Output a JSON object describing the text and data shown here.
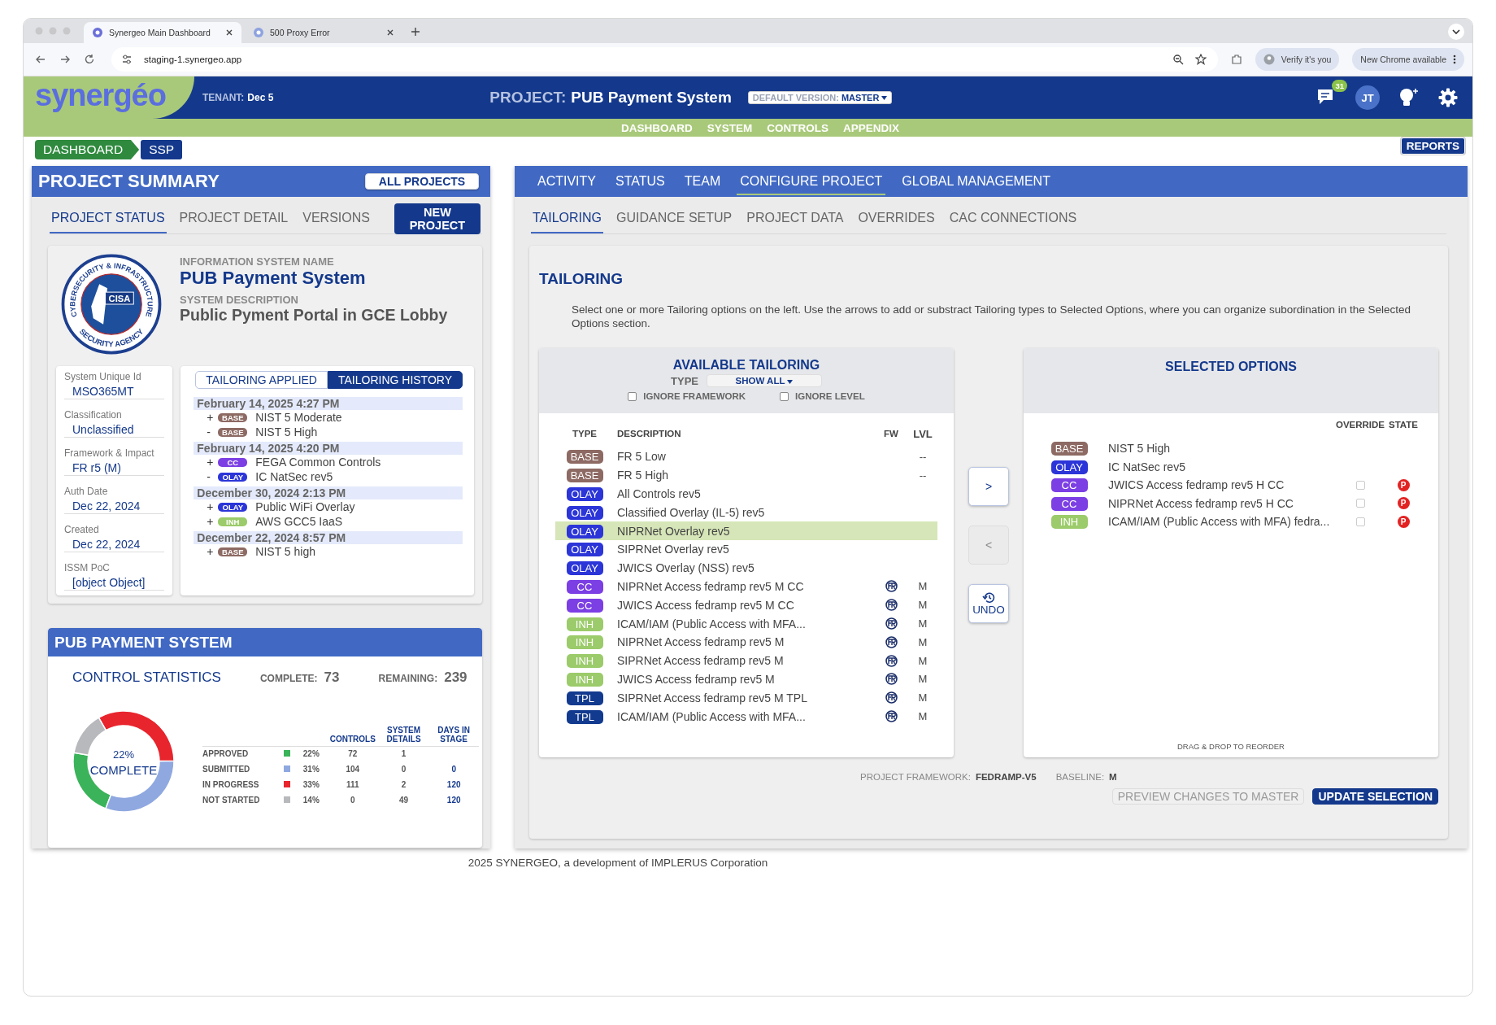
{
  "browser": {
    "tabs": [
      {
        "title": "Synergeo Main Dashboard",
        "selected": true
      },
      {
        "title": "500 Proxy Error",
        "selected": false
      }
    ],
    "address": "staging-1.synergeo.app",
    "verify": "Verify it's you",
    "update": "New Chrome available"
  },
  "header": {
    "logo": "synergéo",
    "tenant_label": "TENANT:",
    "tenant": "Dec 5",
    "project_label": "PROJECT:",
    "project": "PUB Payment System",
    "version_label": "DEFAULT VERSION:",
    "version": "MASTER",
    "notifications": "31",
    "avatar": "JT"
  },
  "nav": [
    "DASHBOARD",
    "SYSTEM",
    "CONTROLS",
    "APPENDIX"
  ],
  "breadcrumb": [
    "DASHBOARD",
    "SSP"
  ],
  "reports": "REPORTS",
  "summary": {
    "title": "PROJECT SUMMARY",
    "all_projects": "ALL PROJECTS",
    "tabs": [
      {
        "label": "PROJECT STATUS",
        "selected": true
      },
      {
        "label": "PROJECT DETAIL",
        "selected": false
      },
      {
        "label": "VERSIONS",
        "selected": false
      }
    ],
    "new_project": "NEW PROJECT",
    "seal": {
      "ring_top": "CYBERSECURITY & INFRASTRUCTURE",
      "ring_bottom": "SECURITY AGENCY",
      "center": "CISA"
    },
    "name_label": "INFORMATION SYSTEM NAME",
    "name": "PUB Payment System",
    "description_label": "SYSTEM DESCRIPTION",
    "description": "Public Pyment Portal in GCE Lobby",
    "details": [
      {
        "label": "System Unique Id",
        "value": "MSO365MT"
      },
      {
        "label": "Classification",
        "value": "Unclassified"
      },
      {
        "label": "Framework & Impact",
        "value": "FR r5 (M)"
      },
      {
        "label": "Auth Date",
        "value": "Dec 22, 2024"
      },
      {
        "label": "Created",
        "value": "Dec 22, 2024"
      },
      {
        "label": "ISSM PoC",
        "value": "[object Object]"
      }
    ],
    "history_tabs": [
      {
        "label": "TAILORING APPLIED",
        "selected": false
      },
      {
        "label": "TAILORING HISTORY",
        "selected": true
      }
    ],
    "history": [
      {
        "date": "February 14, 2025 4:27 PM",
        "changes": [
          {
            "sign": "+",
            "type": "BASE",
            "color": "#8d6a63",
            "name": "NIST 5 Moderate"
          },
          {
            "sign": "-",
            "type": "BASE",
            "color": "#8d6a63",
            "name": "NIST 5 High"
          }
        ]
      },
      {
        "date": "February 14, 2025 4:20 PM",
        "changes": [
          {
            "sign": "+",
            "type": "CC",
            "color": "#7b3fe4",
            "name": "FEGA Common Controls"
          },
          {
            "sign": "-",
            "type": "OLAY",
            "color": "#2b35d8",
            "name": "IC NatSec rev5"
          }
        ]
      },
      {
        "date": "December 30, 2024 2:13 PM",
        "changes": [
          {
            "sign": "+",
            "type": "OLAY",
            "color": "#2b35d8",
            "name": "Public WiFi Overlay"
          },
          {
            "sign": "+",
            "type": "INH",
            "color": "#9bcb6a",
            "name": "AWS GCC5 IaaS"
          }
        ]
      },
      {
        "date": "December 22, 2024 8:57 PM",
        "changes": [
          {
            "sign": "+",
            "type": "BASE",
            "color": "#8d6a63",
            "name": "NIST 5 high"
          }
        ]
      }
    ]
  },
  "stats": {
    "title": "PUB PAYMENT SYSTEM",
    "heading": "CONTROL STATISTICS",
    "complete_label": "COMPLETE:",
    "complete": "73",
    "remaining_label": "REMAINING:",
    "remaining": "239",
    "center_value": "22%",
    "center_label": "COMPLETE",
    "chart_data": {
      "type": "donut",
      "categories": [
        "APPROVED",
        "SUBMITTED",
        "IN PROGRESS",
        "NOT STARTED"
      ],
      "values": [
        22,
        31,
        33,
        14
      ]
    },
    "columns": [
      "CONTROLS",
      "SYSTEM DETAILS",
      "DAYS IN STAGE"
    ],
    "rows": [
      {
        "color": "#3bb35a",
        "pct": "22%",
        "controls": "72",
        "details": "1"
      },
      {
        "color": "#8fa8e0",
        "pct": "31%",
        "controls": "104",
        "details": "0",
        "days": "0"
      },
      {
        "color": "#e8242d",
        "pct": "33%",
        "controls": "111",
        "details": "2",
        "days": "120"
      },
      {
        "color": "#b8b9bd",
        "pct": "14%",
        "controls": "0",
        "details": "49",
        "days": "120"
      }
    ]
  },
  "config": {
    "tabs": [
      {
        "label": "ACTIVITY",
        "selected": false
      },
      {
        "label": "STATUS",
        "selected": false
      },
      {
        "label": "TEAM",
        "selected": false
      },
      {
        "label": "CONFIGURE PROJECT",
        "selected": true
      },
      {
        "label": "GLOBAL MANAGEMENT",
        "selected": false
      }
    ],
    "subtabs": [
      {
        "label": "TAILORING",
        "selected": true
      },
      {
        "label": "GUIDANCE SETUP",
        "selected": false
      },
      {
        "label": "PROJECT DATA",
        "selected": false
      },
      {
        "label": "OVERRIDES",
        "selected": false
      },
      {
        "label": "CAC CONNECTIONS",
        "selected": false
      }
    ],
    "heading": "TAILORING",
    "intro": "Select one or more Tailoring options on the left. Use the arrows to add or substract Tailoring types to Selected Options, where you can organize subordination in the Selected Options section.",
    "available": {
      "title": "AVAILABLE TAILORING",
      "type_label": "TYPE",
      "filter": "SHOW ALL",
      "options": [
        {
          "label": "IGNORE FRAMEWORK",
          "checked": false
        },
        {
          "label": "IGNORE LEVEL",
          "checked": false
        }
      ],
      "columns": [
        "TYPE",
        "DESCRIPTION",
        "FW",
        "LVL"
      ],
      "rows": [
        {
          "type": "BASE",
          "color": "#8d6a63",
          "description": "FR 5 Low",
          "fw": false,
          "lvl": "--",
          "selected": false
        },
        {
          "type": "BASE",
          "color": "#8d6a63",
          "description": "FR 5 High",
          "fw": false,
          "lvl": "--",
          "selected": false
        },
        {
          "type": "OLAY",
          "color": "#2b35d8",
          "description": "All Controls rev5",
          "fw": false,
          "selected": false
        },
        {
          "type": "OLAY",
          "color": "#2b35d8",
          "description": "Classified Overlay (IL-5) rev5",
          "fw": false,
          "selected": false
        },
        {
          "type": "OLAY",
          "color": "#2b35d8",
          "description": "NIPRNet Overlay rev5",
          "fw": false,
          "selected": true
        },
        {
          "type": "OLAY",
          "color": "#2b35d8",
          "description": "SIPRNet Overlay rev5",
          "fw": false,
          "selected": false
        },
        {
          "type": "OLAY",
          "color": "#2b35d8",
          "description": "JWICS Overlay (NSS) rev5",
          "fw": false,
          "selected": false
        },
        {
          "type": "CC",
          "color": "#7b3fe4",
          "description": "NIPRNet Access fedramp rev5 M CC",
          "fw": true,
          "lvl": "M",
          "selected": false
        },
        {
          "type": "CC",
          "color": "#7b3fe4",
          "description": "JWICS Access fedramp rev5 M CC",
          "fw": true,
          "lvl": "M",
          "selected": false
        },
        {
          "type": "INH",
          "color": "#9bcb6a",
          "description": "ICAM/IAM (Public Access with MFA...",
          "fw": true,
          "lvl": "M",
          "selected": false
        },
        {
          "type": "INH",
          "color": "#9bcb6a",
          "description": "NIPRNet Access fedramp rev5 M",
          "fw": true,
          "lvl": "M",
          "selected": false
        },
        {
          "type": "INH",
          "color": "#9bcb6a",
          "description": "SIPRNet Access fedramp rev5 M",
          "fw": true,
          "lvl": "M",
          "selected": false
        },
        {
          "type": "INH",
          "color": "#9bcb6a",
          "description": "JWICS Access fedramp rev5 M",
          "fw": true,
          "lvl": "M",
          "selected": false
        },
        {
          "type": "TPL",
          "color": "#123a8e",
          "description": "SIPRNet Access fedramp rev5 M TPL",
          "fw": true,
          "lvl": "M",
          "selected": false
        },
        {
          "type": "TPL",
          "color": "#123a8e",
          "description": "ICAM/IAM (Public Access with MFA...",
          "fw": true,
          "lvl": "M",
          "selected": false
        }
      ]
    },
    "moves": [
      {
        "label": ">",
        "disabled": false
      },
      {
        "label": "<",
        "disabled": true
      }
    ],
    "undo": "UNDO",
    "selected": {
      "title": "SELECTED OPTIONS",
      "columns": [
        "OVERRIDE",
        "STATE"
      ],
      "rows": [
        {
          "type": "BASE",
          "color": "#8d6a63",
          "name": "NIST 5 High"
        },
        {
          "type": "OLAY",
          "color": "#2b35d8",
          "name": "IC NatSec rev5"
        },
        {
          "type": "CC",
          "color": "#7b3fe4",
          "name": "JWICS Access fedramp rev5 H CC",
          "override": false,
          "state": "P"
        },
        {
          "type": "CC",
          "color": "#7b3fe4",
          "name": "NIPRNet Access fedramp rev5 H CC",
          "override": false,
          "state": "P"
        },
        {
          "type": "INH",
          "color": "#9bcb6a",
          "name": "ICAM/IAM (Public Access with MFA) fedra...",
          "override": false,
          "state": "P"
        }
      ],
      "hint": "DRAG & DROP TO REORDER"
    },
    "framework_label": "PROJECT FRAMEWORK:",
    "framework": "FEDRAMP-V5",
    "baseline_label": "BASELINE:",
    "baseline": "M",
    "actions": [
      {
        "label": "PREVIEW CHANGES TO MASTER",
        "disabled": true
      },
      {
        "label": "UPDATE SELECTION",
        "disabled": false
      }
    ]
  },
  "footer": "2025 SYNERGEO, a development of IMPLERUS Corporation"
}
